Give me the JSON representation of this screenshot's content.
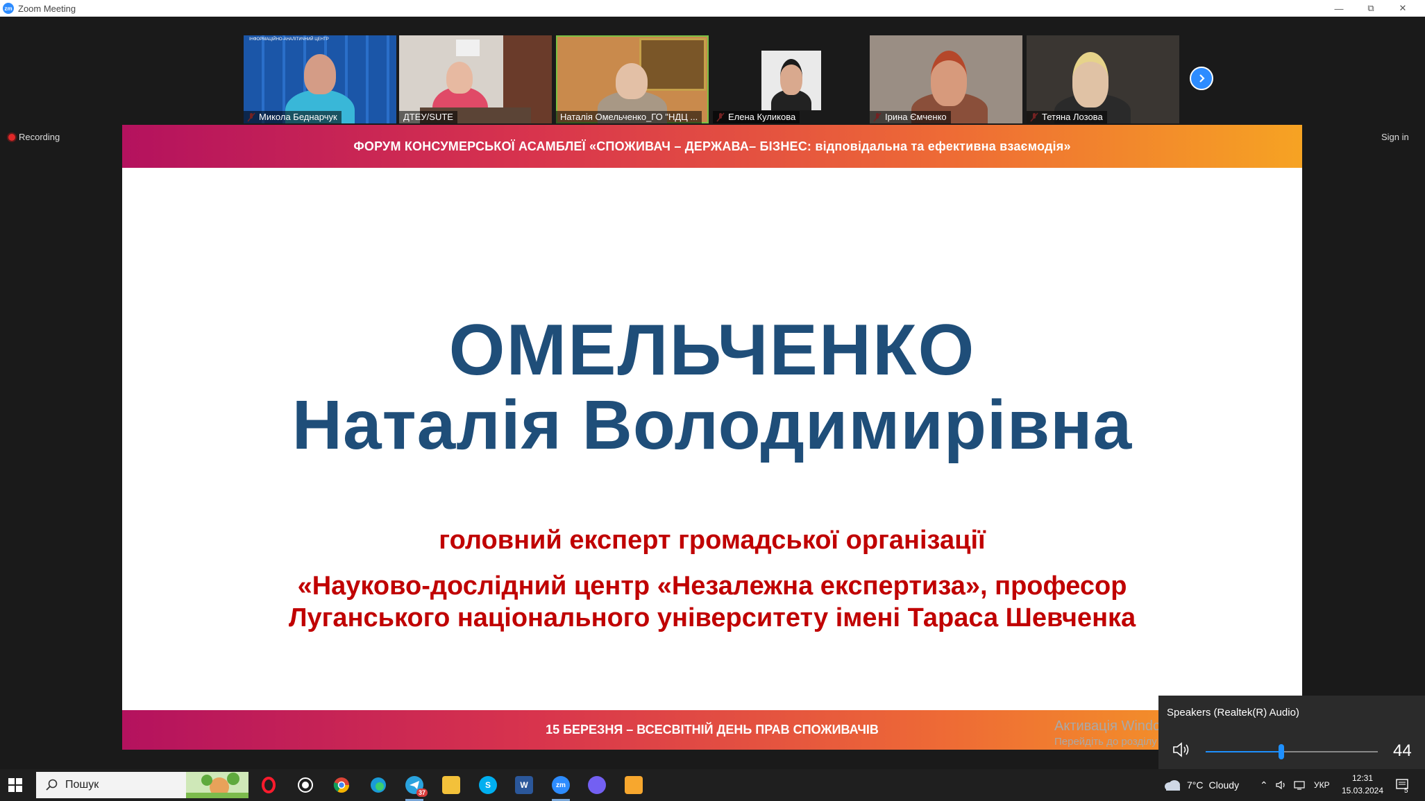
{
  "window": {
    "title": "Zoom Meeting",
    "app_icon_text": "zm"
  },
  "gallery": {
    "participants": [
      {
        "name": "Микола Беднарчук",
        "muted": true
      },
      {
        "name": "ДТЕУ/SUTE",
        "muted": false
      },
      {
        "name": "Наталія Омельченко_ГО \"НДЦ ...",
        "muted": false,
        "active_speaker": true
      },
      {
        "name": "Елена Куликова",
        "muted": true
      },
      {
        "name": "Ірина Ємченко",
        "muted": true
      },
      {
        "name": "Тетяна Лозова",
        "muted": true
      }
    ],
    "tile1_banner": "ІНФОРМАЦІЙНО-АНАЛІТИЧНИЙ ЦЕНТР"
  },
  "meeting": {
    "recording_label": "Recording",
    "signin_label": "Sign in"
  },
  "slide": {
    "header": "ФОРУМ КОНСУМЕРСЬКОЇ АСАМБЛЕЇ «СПОЖИВАЧ – ДЕРЖАВА– БІЗНЕС: відповідальна та ефективна взаємодія»",
    "surname": "ОМЕЛЬЧЕНКО",
    "given_name": "Наталія Володимирівна",
    "role": "головний експерт громадської організації",
    "org_line1": "«Науково-дослідний центр «Незалежна експертиза», професор",
    "org_line2": "Луганського національного університету імені Тараса Шевченка",
    "footer": "15 БЕРЕЗНЯ – ВСЕСВІТНІЙ ДЕНЬ ПРАВ СПОЖИВАЧІВ",
    "colors": {
      "accent_blue": "#1f4e79",
      "accent_red": "#c00000",
      "band_start": "#b4125e",
      "band_end": "#f6a323"
    }
  },
  "watermark": {
    "line1": "Активація Windows",
    "line2": "Перейдіть до розділу \"Настройки\", щоб активувати Windows."
  },
  "volume": {
    "device": "Speakers (Realtek(R) Audio)",
    "level": 44,
    "level_text": "44"
  },
  "taskbar": {
    "search_label": "Пошук",
    "apps": [
      "opera-icon",
      "whatsapp-icon",
      "chrome-icon",
      "edge-icon",
      "telegram-icon",
      "file-explorer-icon",
      "skype-icon",
      "word-icon",
      "zoom-icon",
      "viber-icon",
      "pdf-icon"
    ],
    "telegram_badge": "37",
    "weather": {
      "temp": "7°C",
      "condition": "Cloudy"
    },
    "language": "УКР",
    "time": "12:31",
    "date": "15.03.2024",
    "notification_count": "5"
  }
}
